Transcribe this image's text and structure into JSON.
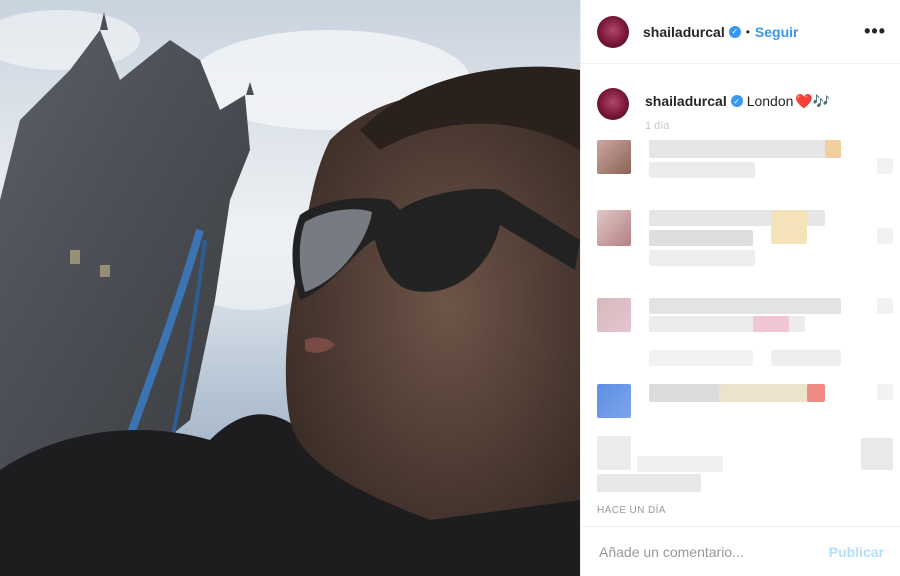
{
  "post": {
    "username": "shailadurcal",
    "verified_icon": "verified-check-icon",
    "dot": "•",
    "follow_label": "Seguir",
    "more_label": "•••",
    "caption_text": "London",
    "caption_emoji": "❤️🎶",
    "time_small": "1 día",
    "time_label": "HACE UN DÍA"
  },
  "comment_box": {
    "placeholder": "Añade un comentario...",
    "publish_label": "Publicar"
  },
  "colors": {
    "accent_blue": "#3897f0",
    "publish_disabled": "#b2dffc",
    "divider": "#efefef"
  }
}
